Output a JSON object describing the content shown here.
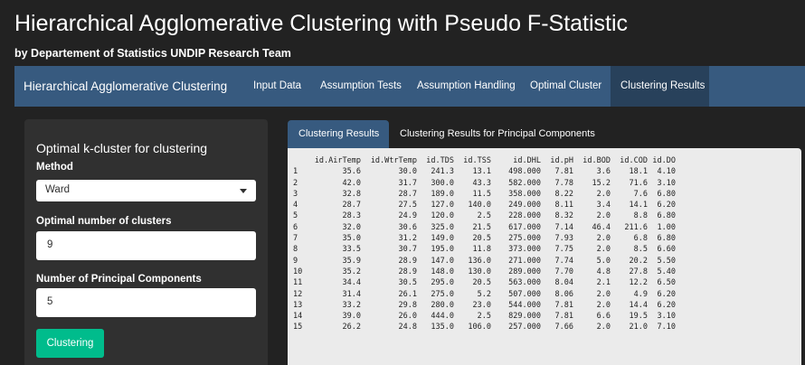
{
  "app": {
    "title": "Hierarchical Agglomerative Clustering with Pseudo F-Statistic",
    "subtitle": "by Departement of Statistics UNDIP Research Team"
  },
  "navbar": {
    "brand": "Hierarchical Agglomerative Clustering",
    "items": [
      {
        "label": "Input Data",
        "active": false
      },
      {
        "label": "Assumption Tests",
        "active": false
      },
      {
        "label": "Assumption Handling",
        "active": false
      },
      {
        "label": "Optimal Cluster",
        "active": false
      },
      {
        "label": "Clustering Results",
        "active": true
      }
    ]
  },
  "sidebar": {
    "heading": "Optimal k-cluster for clustering",
    "method_label": "Method",
    "method_value": "Ward",
    "clusters_label": "Optimal number of clusters",
    "clusters_value": "9",
    "pc_label": "Number of Principal Components",
    "pc_value": "5",
    "button_label": "Clustering"
  },
  "tabs": [
    {
      "label": "Clustering Results",
      "active": true
    },
    {
      "label": "Clustering Results for Principal Components",
      "active": false
    }
  ],
  "table": {
    "columns": [
      "id.AirTemp",
      "id.WtrTemp",
      "id.TDS",
      "id.TSS",
      "id.DHL",
      "id.pH",
      "id.BOD",
      "id.COD",
      "id.DO"
    ],
    "rows": [
      [
        "1",
        "35.6",
        "30.0",
        "241.3",
        "13.1",
        "498.000",
        "7.81",
        "3.6",
        "18.1",
        "4.10"
      ],
      [
        "2",
        "42.0",
        "31.7",
        "300.0",
        "43.3",
        "582.000",
        "7.78",
        "15.2",
        "71.6",
        "3.10"
      ],
      [
        "3",
        "32.8",
        "28.7",
        "189.0",
        "11.5",
        "358.000",
        "8.22",
        "2.0",
        "7.6",
        "6.80"
      ],
      [
        "4",
        "28.7",
        "27.5",
        "127.0",
        "140.0",
        "249.000",
        "8.11",
        "3.4",
        "14.1",
        "6.20"
      ],
      [
        "5",
        "28.3",
        "24.9",
        "120.0",
        "2.5",
        "228.000",
        "8.32",
        "2.0",
        "8.8",
        "6.80"
      ],
      [
        "6",
        "32.0",
        "30.6",
        "325.0",
        "21.5",
        "617.000",
        "7.14",
        "46.4",
        "211.6",
        "1.00"
      ],
      [
        "7",
        "35.0",
        "31.2",
        "149.0",
        "20.5",
        "275.000",
        "7.93",
        "2.0",
        "6.8",
        "6.80"
      ],
      [
        "8",
        "33.5",
        "30.7",
        "195.0",
        "11.8",
        "373.000",
        "7.75",
        "2.0",
        "8.5",
        "6.60"
      ],
      [
        "9",
        "35.9",
        "28.9",
        "147.0",
        "136.0",
        "271.000",
        "7.74",
        "5.0",
        "20.2",
        "5.50"
      ],
      [
        "10",
        "35.2",
        "28.9",
        "148.0",
        "130.0",
        "289.000",
        "7.70",
        "4.8",
        "27.8",
        "5.40"
      ],
      [
        "11",
        "34.4",
        "30.5",
        "295.0",
        "20.5",
        "563.000",
        "8.04",
        "2.1",
        "12.2",
        "6.50"
      ],
      [
        "12",
        "31.4",
        "26.1",
        "275.0",
        "5.2",
        "507.000",
        "8.06",
        "2.0",
        "4.9",
        "6.20"
      ],
      [
        "13",
        "33.2",
        "29.8",
        "280.0",
        "23.0",
        "544.000",
        "7.81",
        "2.0",
        "14.4",
        "6.20"
      ],
      [
        "14",
        "39.0",
        "26.0",
        "444.0",
        "2.5",
        "829.000",
        "7.81",
        "6.6",
        "19.5",
        "3.10"
      ],
      [
        "15",
        "26.2",
        "24.8",
        "135.0",
        "106.0",
        "257.000",
        "7.66",
        "2.0",
        "21.0",
        "7.10"
      ]
    ]
  },
  "colors": {
    "background": "#222222",
    "navbar": "#375a7f",
    "navbar_active": "#28415b",
    "sidebar": "#303030",
    "button": "#00bc8c",
    "output_bg": "#ebebeb"
  }
}
